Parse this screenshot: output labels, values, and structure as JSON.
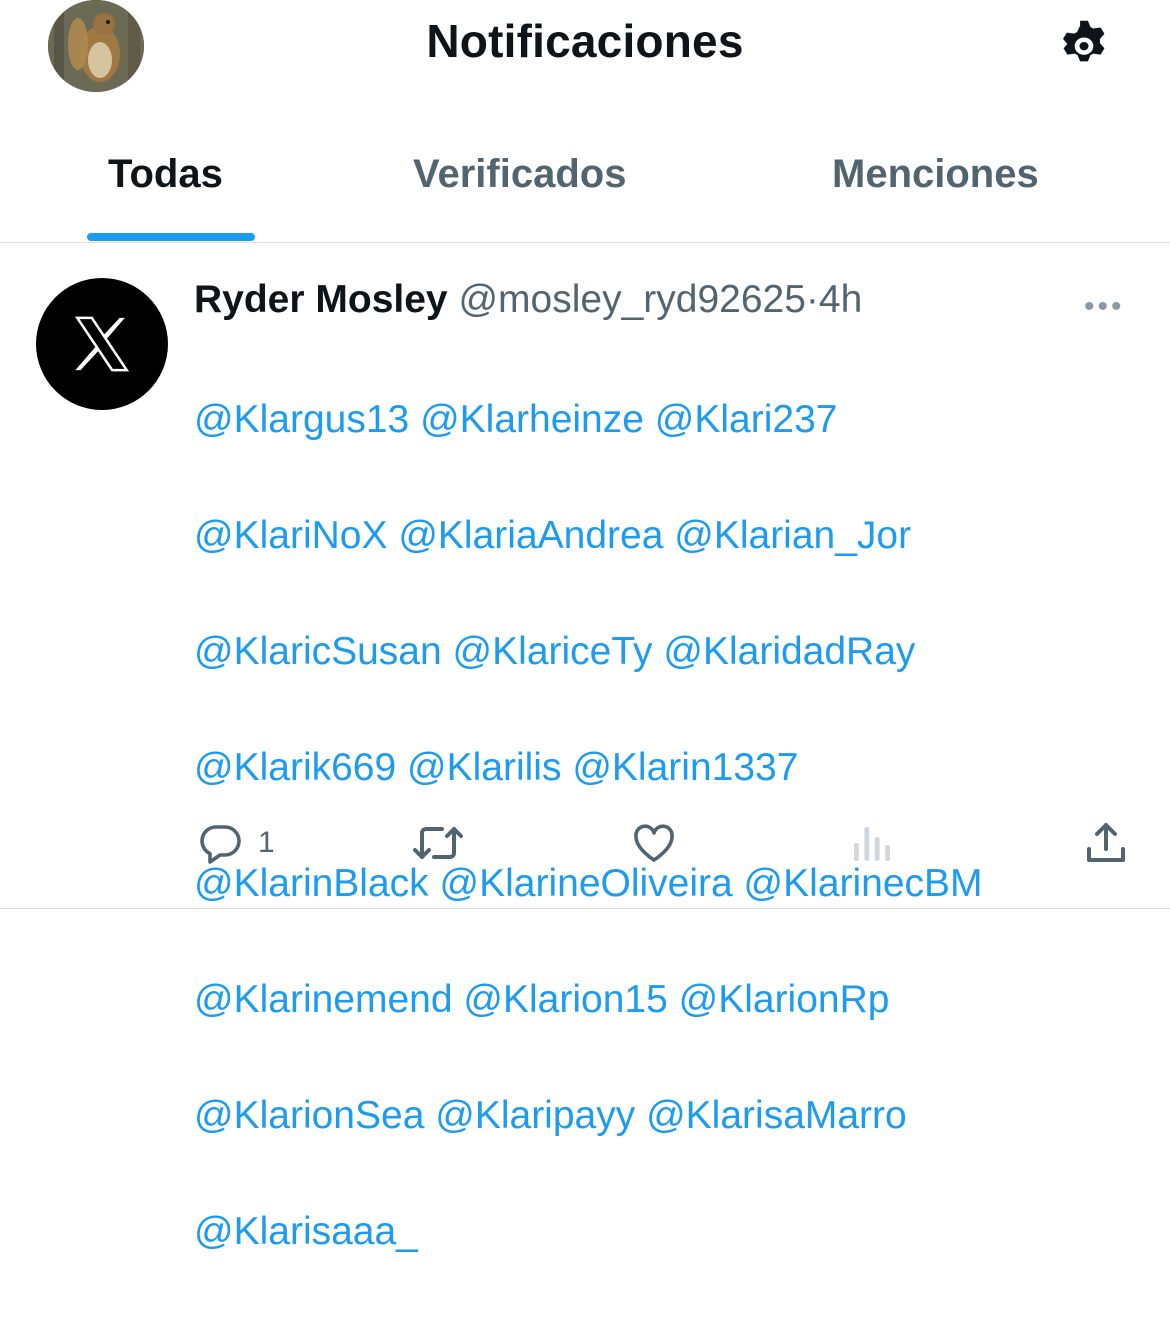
{
  "header": {
    "title": "Notificaciones"
  },
  "tabs": [
    {
      "label": "Todas",
      "active": true
    },
    {
      "label": "Verificados",
      "active": false
    },
    {
      "label": "Menciones",
      "active": false
    }
  ],
  "tweet": {
    "display_name": "Ryder Mosley",
    "handle": "@mosley_ryd92625",
    "separator": "·",
    "time": "4h",
    "more": "•••",
    "lines": [
      [
        "@Klargus13",
        "@Klarheinze",
        "@Klari237"
      ],
      [
        "@KlariNoX",
        "@KlariaAndrea",
        "@Klarian_Jor"
      ],
      [
        "@KlaricSusan",
        "@KlariceTy",
        "@KlaridadRay"
      ],
      [
        "@Klarik669",
        "@Klarilis",
        "@Klarin1337"
      ],
      [
        "@KlarinBlack",
        "@KlarineOliveira",
        "@KlarinecBM"
      ],
      [
        "@Klarinemend",
        "@Klarion15",
        "@KlarionRp"
      ],
      [
        "@KlarionSea",
        "@Klaripayy",
        "@KlarisaMarro"
      ],
      [
        "@Klarisaaa_"
      ]
    ],
    "actions": {
      "reply_count": "1",
      "retweet_count": "",
      "like_count": "",
      "views_count": ""
    }
  },
  "icons": {
    "avatar": "squirrel-photo",
    "settings": "gear-icon",
    "tweet_avatar": "x-logo",
    "reply": "reply-icon",
    "retweet": "retweet-icon",
    "like": "heart-icon",
    "views": "views-icon",
    "share": "share-icon"
  },
  "colors": {
    "accent": "#1d9bf0",
    "secondary_text": "#536471",
    "primary_text": "#0f1419"
  }
}
